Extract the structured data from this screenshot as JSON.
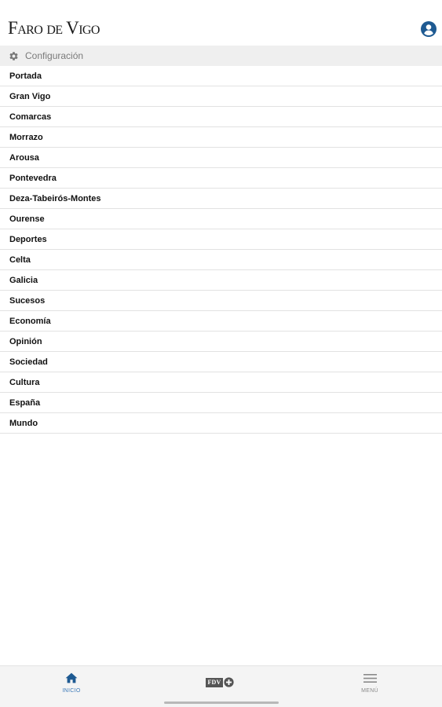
{
  "header": {
    "logo": "Faro de Vigo",
    "user_icon": "user-circle-icon"
  },
  "config": {
    "icon": "gear-icon",
    "label": "Configuración"
  },
  "sections": [
    {
      "label": "Portada"
    },
    {
      "label": "Gran Vigo"
    },
    {
      "label": "Comarcas"
    },
    {
      "label": "Morrazo"
    },
    {
      "label": "Arousa"
    },
    {
      "label": "Pontevedra"
    },
    {
      "label": "Deza-Tabeirós-Montes"
    },
    {
      "label": "Ourense"
    },
    {
      "label": "Deportes"
    },
    {
      "label": "Celta"
    },
    {
      "label": "Galicia"
    },
    {
      "label": "Sucesos"
    },
    {
      "label": "Economía"
    },
    {
      "label": "Opinión"
    },
    {
      "label": "Sociedad"
    },
    {
      "label": "Cultura"
    },
    {
      "label": "España"
    },
    {
      "label": "Mundo"
    }
  ],
  "tabbar": {
    "inicio": {
      "icon": "home-icon",
      "label": "INICIO"
    },
    "fdv": {
      "icon": "fdv-plus-icon",
      "label": "FDV"
    },
    "menu": {
      "icon": "hamburger-menu-icon",
      "label": "MENÚ"
    }
  },
  "colors": {
    "accent": "#1e5a92",
    "active_tab": "#3b79b8",
    "config_bar_bg": "#efefef",
    "tabbar_bg": "#f4f4f4"
  }
}
